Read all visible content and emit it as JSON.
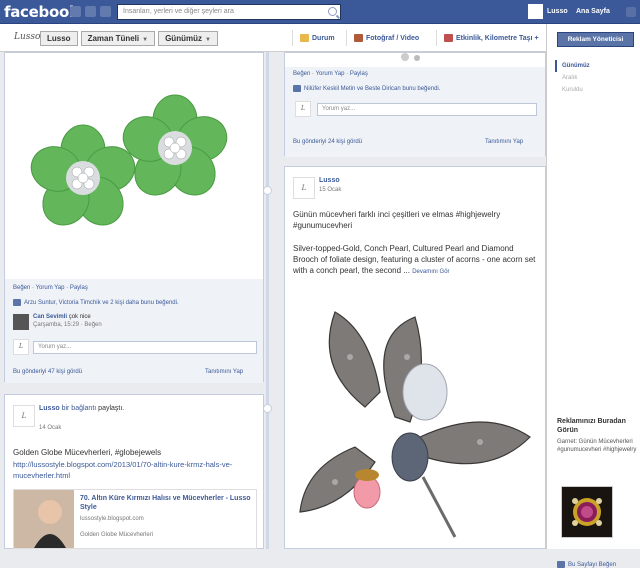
{
  "topbar": {
    "logo": "facebook",
    "search_placeholder": "İnsanları, yerleri ve diğer şeyleri ara",
    "user_name": "Lusso",
    "home_label": "Ana Sayfa"
  },
  "navbar": {
    "page_logo": "Lusso",
    "crumbs": [
      "Lusso",
      "Zaman Tüneli",
      "Günümüz"
    ],
    "composer": [
      "Durum",
      "Fotoğraf / Video",
      "Etkinlik, Kilometre Taşı +"
    ]
  },
  "right_panel": {
    "ad_manager_button": "Reklam Yöneticisi",
    "years": [
      "Günümüz",
      "Aralık",
      "Kuruldu"
    ],
    "ads_title": "Reklamınızı Buradan Görün",
    "ad_description": "Garnet: Günün Mücevherleri #gunumucevheri #highjewelry",
    "ad_like": "Bu Sayfayı Beğen"
  },
  "post1": {
    "actions": "Beğen · Yorum Yap · Paylaş",
    "likes": "Arzu Suntur, Victoria Timchik ve 2 kişi daha bunu beğendi.",
    "comment_author": "Can Sevimli",
    "comment_text": "çok nice",
    "comment_meta": "Çarşamba, 15:29 · Beğen",
    "comment_placeholder": "Yorum yaz...",
    "seen": "Bu gönderiyi 47 kişi gördü",
    "target": "Tanıtımını Yap"
  },
  "post2": {
    "actions": "Beğen · Yorum Yap · Paylaş",
    "likes": "Nilüfer Keskil Metin ve Beste Dirican bunu beğendi.",
    "comment_placeholder": "Yorum yaz...",
    "seen": "Bu gönderiyi 24 kişi gördü",
    "target": "Tanıtımını Yap"
  },
  "post3": {
    "author": "Lusso",
    "date": "15 Ocak",
    "text1": "Günün mücevheri farklı inci çeşitleri ve elmas #highjewelry #gunumucevheri",
    "text2": "Silver-topped-Gold, Conch Pearl, Cultured Pearl and Diamond Brooch of foliate design, featuring a cluster of acorns - one acorn set with a conch pearl, the second ...",
    "see_more": "Devamını Gör"
  },
  "post4": {
    "author": "Lusso",
    "shared": "bir bağlantı",
    "shared_suffix": "paylaştı.",
    "date": "14 Ocak",
    "text": "Golden Globe Mücevherleri, #globejewels",
    "url": "http://lussostyle.blogspot.com/2013/01/70-altin-kure-krmz-hals-ve-mucevherler.html",
    "link_title": "70. Altın Küre Kırmızı Halısı ve Mücevherler - Lusso Style",
    "link_domain": "lussostyle.blogspot.com",
    "link_desc": "Golden Globe Mücevherleri"
  },
  "colors": {
    "brand": "#3b5998",
    "bg": "#e9ebee",
    "jade": "#5cb85c"
  }
}
